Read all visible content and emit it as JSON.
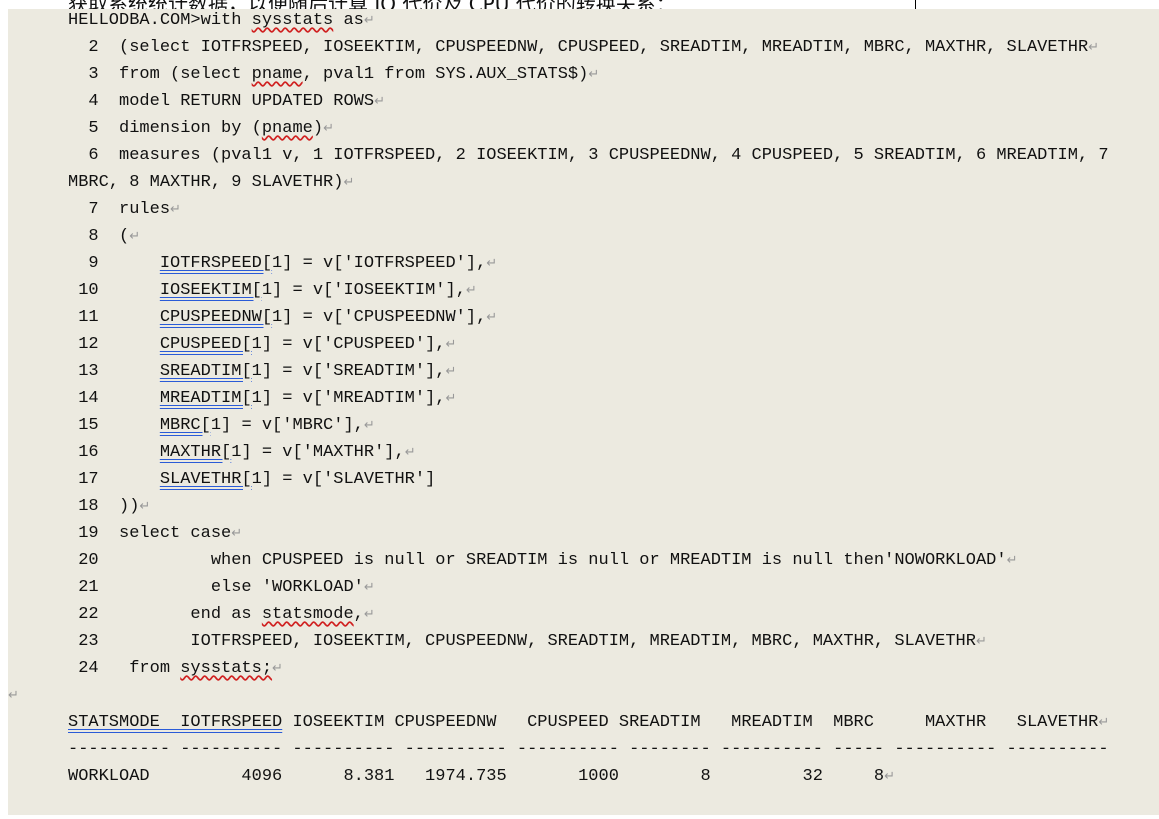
{
  "document": {
    "heading_partial": "获取系统统计数据，以便随后计算 IO 代价及 CPU 代价的转换关系：",
    "colors": {
      "shading": "#eceae0",
      "spell_underline": "#d02020",
      "grammar_underline": "#2a5bd7",
      "paragraph_mark": "#999999"
    },
    "lines": [
      {
        "segs": [
          [
            "HELLODBA.COM>with ",
            "n"
          ],
          [
            "sysstats",
            "w"
          ],
          [
            " as",
            "n"
          ]
        ],
        "para": true
      },
      {
        "segs": [
          [
            "  2  (select IOTFRSPEED, IOSEEKTIM, CPUSPEEDNW, CPUSPEED, SREADTIM, MREADTIM, MBRC, MAXTHR, SLAVETHR",
            "n"
          ]
        ],
        "para": true
      },
      {
        "segs": [
          [
            "  3  from (select ",
            "n"
          ],
          [
            "pname",
            "w"
          ],
          [
            ", pval1 from SYS.AUX_STATS$)",
            "n"
          ]
        ],
        "para": true
      },
      {
        "segs": [
          [
            "  4  model RETURN UPDATED ROWS",
            "n"
          ]
        ],
        "para": true
      },
      {
        "segs": [
          [
            "  5  dimension by (",
            "n"
          ],
          [
            "pname",
            "w"
          ],
          [
            ")",
            "n"
          ]
        ],
        "para": true
      },
      {
        "segs": [
          [
            "  6  measures (pval1 v, 1 IOTFRSPEED, 2 IOSEEKTIM, 3 CPUSPEEDNW, 4 CPUSPEED, 5 SREADTIM, 6 MREADTIM, 7",
            "n"
          ]
        ],
        "para": false
      },
      {
        "segs": [
          [
            "MBRC, 8 MAXTHR, 9 SLAVETHR)",
            "n"
          ]
        ],
        "para": true
      },
      {
        "segs": [
          [
            "  7  rules",
            "n"
          ]
        ],
        "para": true
      },
      {
        "segs": [
          [
            "  8  (",
            "n"
          ]
        ],
        "para": true
      },
      {
        "segs": [
          [
            "  9      ",
            "n"
          ],
          [
            "IOTFRSPEED[",
            "b"
          ],
          [
            "1] = v['IOTFRSPEED'],",
            "n"
          ]
        ],
        "para": true
      },
      {
        "segs": [
          [
            " 10      ",
            "n"
          ],
          [
            "IOSEEKTIM[",
            "b"
          ],
          [
            "1] = v['IOSEEKTIM'],",
            "n"
          ]
        ],
        "para": true
      },
      {
        "segs": [
          [
            " 11      ",
            "n"
          ],
          [
            "CPUSPEEDNW[",
            "b"
          ],
          [
            "1] = v['CPUSPEEDNW'],",
            "n"
          ]
        ],
        "para": true
      },
      {
        "segs": [
          [
            " 12      ",
            "n"
          ],
          [
            "CPUSPEED[",
            "b"
          ],
          [
            "1] = v['CPUSPEED'],",
            "n"
          ]
        ],
        "para": true
      },
      {
        "segs": [
          [
            " 13      ",
            "n"
          ],
          [
            "SREADTIM[",
            "b"
          ],
          [
            "1] = v['SREADTIM'],",
            "n"
          ]
        ],
        "para": true
      },
      {
        "segs": [
          [
            " 14      ",
            "n"
          ],
          [
            "MREADTIM[",
            "b"
          ],
          [
            "1] = v['MREADTIM'],",
            "n"
          ]
        ],
        "para": true
      },
      {
        "segs": [
          [
            " 15      ",
            "n"
          ],
          [
            "MBRC[",
            "b"
          ],
          [
            "1] = v['MBRC'],",
            "n"
          ]
        ],
        "para": true
      },
      {
        "segs": [
          [
            " 16      ",
            "n"
          ],
          [
            "MAXTHR[",
            "b"
          ],
          [
            "1] = v['MAXTHR'],",
            "n"
          ]
        ],
        "para": true
      },
      {
        "segs": [
          [
            " 17      ",
            "n"
          ],
          [
            "SLAVETHR[",
            "b"
          ],
          [
            "1] = v['SLAVETHR']",
            "n"
          ]
        ],
        "para": false
      },
      {
        "segs": [
          [
            " 18  ))",
            "n"
          ]
        ],
        "para": true
      },
      {
        "segs": [
          [
            " 19  select case",
            "n"
          ]
        ],
        "para": true
      },
      {
        "segs": [
          [
            " 20           when CPUSPEED is null or SREADTIM is null or MREADTIM is null then'NOWORKLOAD'",
            "n"
          ]
        ],
        "para": true
      },
      {
        "segs": [
          [
            " 21           else 'WORKLOAD'",
            "n"
          ]
        ],
        "para": true
      },
      {
        "segs": [
          [
            " 22         end as ",
            "n"
          ],
          [
            "statsmode",
            "w"
          ],
          [
            ",",
            "n"
          ]
        ],
        "para": true
      },
      {
        "segs": [
          [
            " 23         IOTFRSPEED, IOSEEKTIM, CPUSPEEDNW, SREADTIM, MREADTIM, MBRC, MAXTHR, SLAVETHR",
            "n"
          ]
        ],
        "para": true
      },
      {
        "segs": [
          [
            " 24   from ",
            "n"
          ],
          [
            "sysstats;",
            "w"
          ]
        ],
        "para": true
      },
      {
        "segs": [],
        "para": true,
        "outdent": true
      },
      {
        "segs": [
          [
            "STATSMODE  IOTFRSPEED",
            "b"
          ],
          [
            " IOSEEKTIM CPUSPEEDNW   CPUSPEED SREADTIM   MREADTIM  MBRC     MAXTHR   SLAVETHR",
            "n"
          ]
        ],
        "para": true
      },
      {
        "segs": [
          [
            "---------- ---------- ---------- ---------- ---------- -------- ---------- ----- ---------- ----------",
            "n"
          ]
        ],
        "para": false
      },
      {
        "segs": [
          [
            "WORKLOAD         4096      8.381   1974.735       1000        8         32     8",
            "n"
          ]
        ],
        "para": true
      }
    ],
    "paragraph_mark": "↵"
  }
}
